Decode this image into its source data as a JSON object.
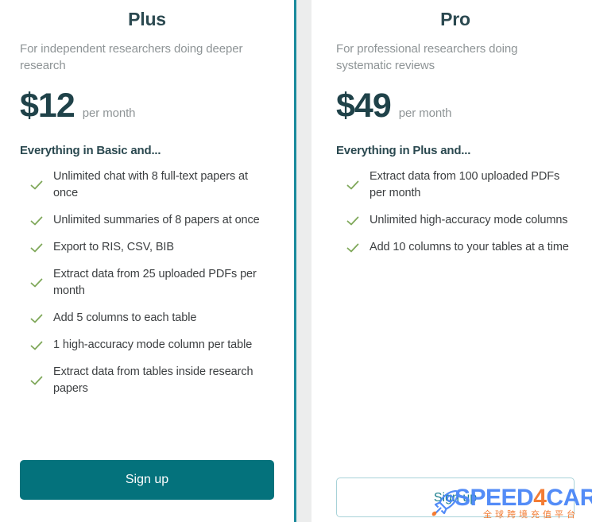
{
  "theme": {
    "title_color": "#2b4950",
    "price_color": "#1f4249",
    "muted_color": "#8e9496",
    "feature_color": "#3c3f41",
    "check_color": "#7fa85a",
    "primary_button_bg": "#04727c",
    "secondary_button_border": "#a8d2d8",
    "secondary_button_text": "#1b7f8d",
    "divider_rule_color": "#1a8a9c",
    "divider_gutter_color": "#eceded"
  },
  "plans": [
    {
      "id": "plus",
      "name": "Plus",
      "description": "For independent researchers doing deeper research",
      "price": "$12",
      "period": "per month",
      "includes_heading": "Everything in Basic and...",
      "features": [
        "Unlimited chat with 8 full-text papers at once",
        "Unlimited summaries of 8 papers at once",
        "Export to RIS, CSV, BIB",
        "Extract data from 25 uploaded PDFs per month",
        "Add 5 columns to each table",
        "1 high-accuracy mode column per table",
        "Extract data from tables inside research papers"
      ],
      "cta_label": "Sign up",
      "cta_style": "primary"
    },
    {
      "id": "pro",
      "name": "Pro",
      "description": "For professional researchers doing systematic reviews",
      "price": "$49",
      "period": "per month",
      "includes_heading": "Everything in Plus and...",
      "features": [
        "Extract data from 100 uploaded PDFs per month",
        "Unlimited high-accuracy mode columns",
        "Add 10 columns to your tables at a time"
      ],
      "cta_label": "Sign up",
      "cta_style": "secondary"
    }
  ],
  "icons": {
    "check": "check-icon",
    "rocket": "rocket-icon"
  },
  "watermark": {
    "brand_part1": "SPEED",
    "brand_part2": "4",
    "brand_part3": "CARD",
    "subtitle": "全球跨境充值平台"
  }
}
